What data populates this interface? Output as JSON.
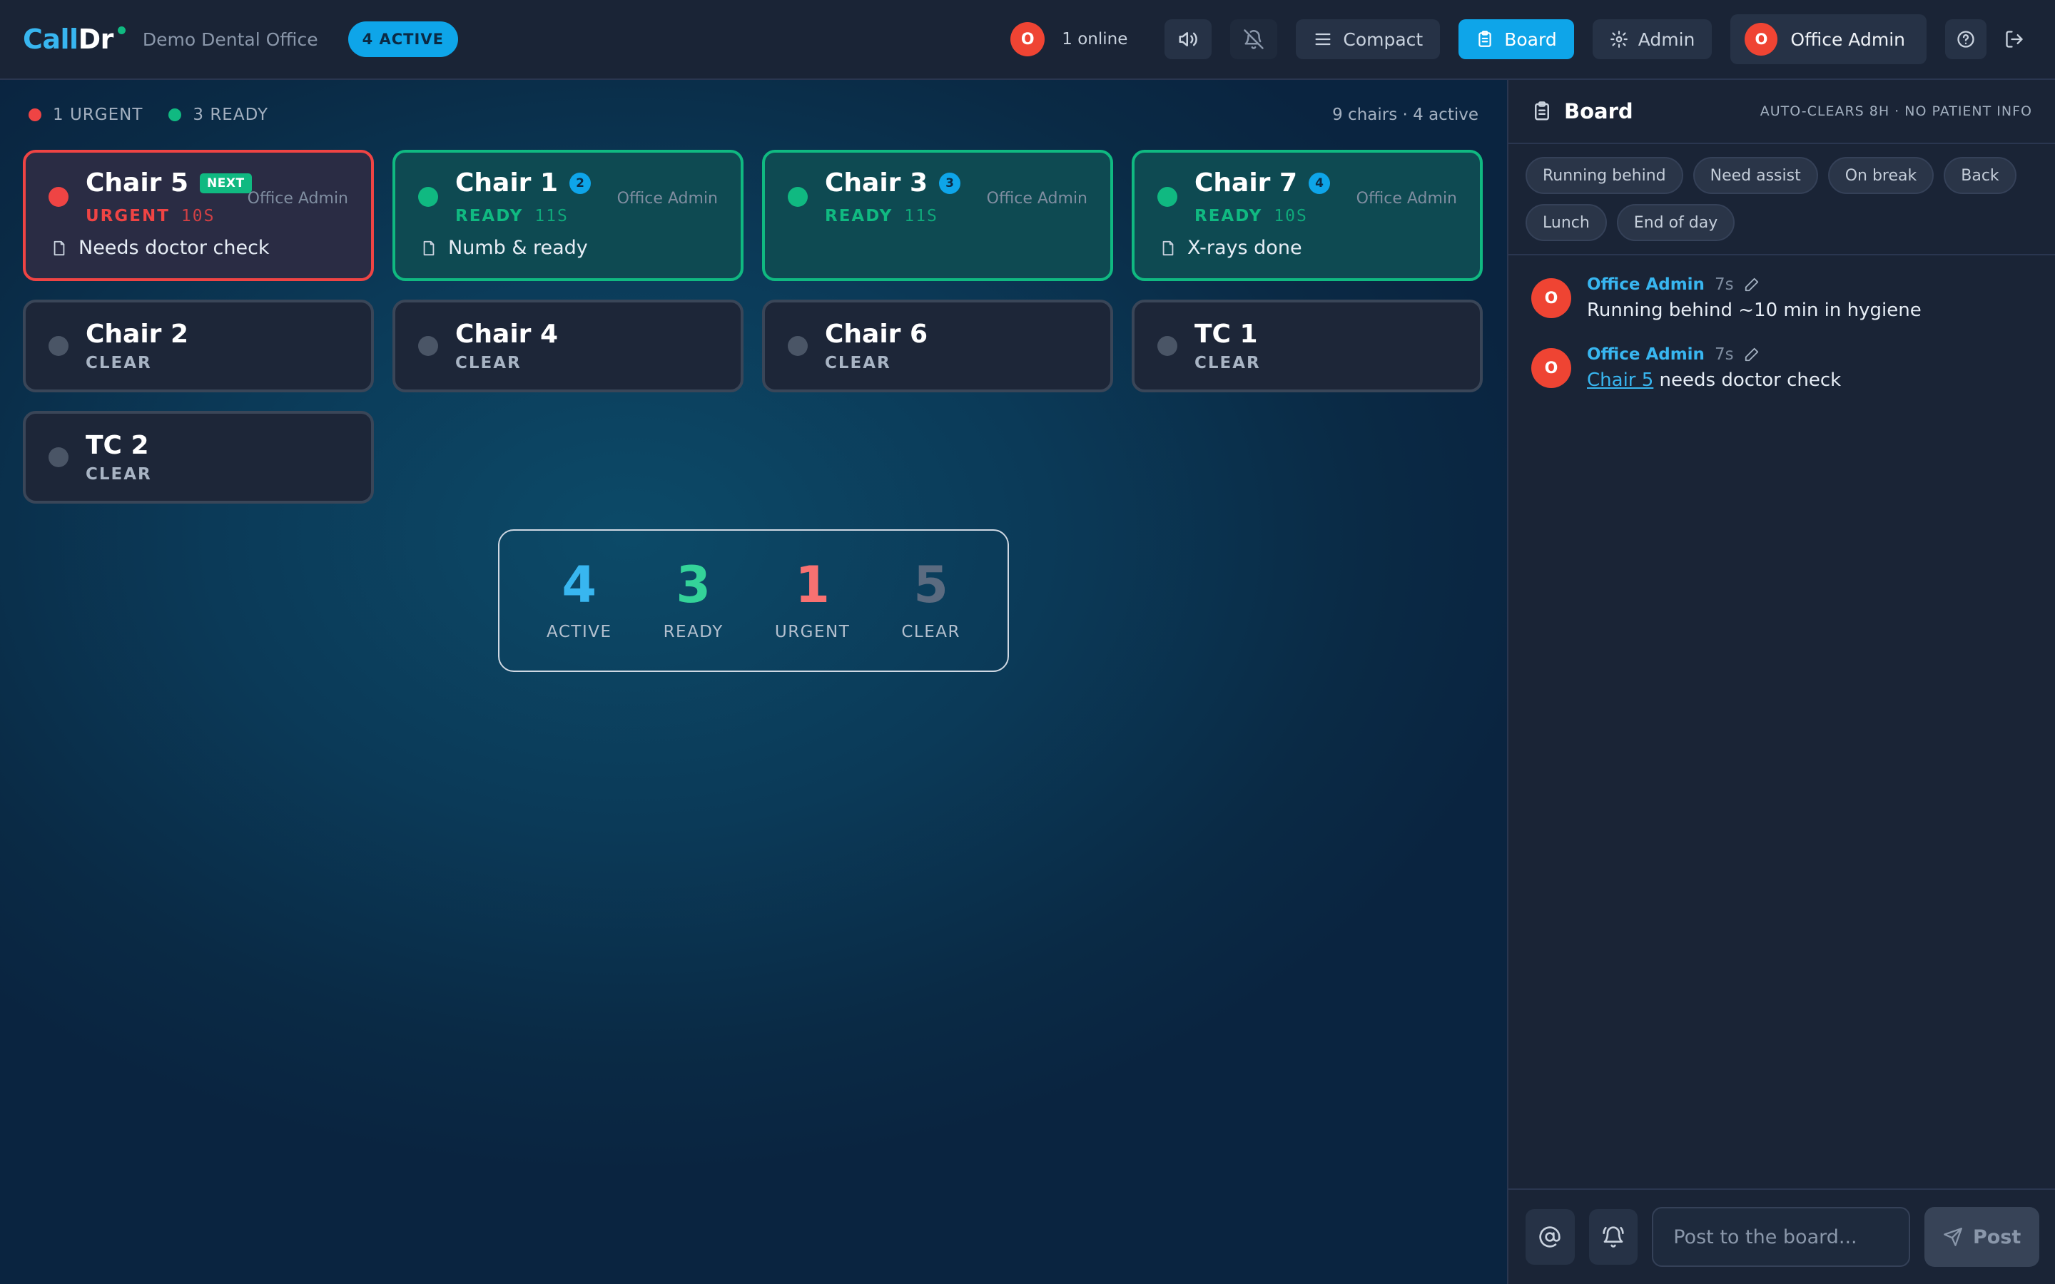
{
  "header": {
    "logo_call": "Call",
    "logo_dr": "Dr",
    "office_name": "Demo Dental Office",
    "active_badge": "4 ACTIVE",
    "online_avatar_initial": "O",
    "online_text": "1 online",
    "compact_label": "Compact",
    "board_label": "Board",
    "admin_label": "Admin",
    "user_initial": "O",
    "user_name": "Office Admin"
  },
  "summary": {
    "urgent_text": "1 URGENT",
    "ready_text": "3 READY",
    "chair_count_text": "9 chairs · 4 active"
  },
  "chairs": [
    {
      "name": "Chair 5",
      "badge": "NEXT",
      "status": "URGENT",
      "time": "10S",
      "owner": "Office Admin",
      "note": "Needs doctor check"
    },
    {
      "name": "Chair 1",
      "badge": "2",
      "status": "READY",
      "time": "11S",
      "owner": "Office Admin",
      "note": "Numb & ready"
    },
    {
      "name": "Chair 3",
      "badge": "3",
      "status": "READY",
      "time": "11S",
      "owner": "Office Admin",
      "note": ""
    },
    {
      "name": "Chair 7",
      "badge": "4",
      "status": "READY",
      "time": "10S",
      "owner": "Office Admin",
      "note": "X-rays done"
    },
    {
      "name": "Chair 2",
      "status": "CLEAR"
    },
    {
      "name": "Chair 4",
      "status": "CLEAR"
    },
    {
      "name": "Chair 6",
      "status": "CLEAR"
    },
    {
      "name": "TC 1",
      "status": "CLEAR"
    },
    {
      "name": "TC 2",
      "status": "CLEAR"
    }
  ],
  "stats": [
    {
      "value": "4",
      "label": "ACTIVE",
      "color": "#38b6f0"
    },
    {
      "value": "3",
      "label": "READY",
      "color": "#34d399"
    },
    {
      "value": "1",
      "label": "URGENT",
      "color": "#f87171"
    },
    {
      "value": "5",
      "label": "CLEAR",
      "color": "#5b6b80"
    }
  ],
  "panel": {
    "title": "Board",
    "note": "AUTO-CLEARS 8H · NO PATIENT INFO",
    "quick_actions": [
      "Running behind",
      "Need assist",
      "On break",
      "Back",
      "Lunch",
      "End of day"
    ],
    "messages": [
      {
        "initial": "O",
        "author": "Office Admin",
        "time": "7s",
        "text": "Running behind ~10 min in hygiene"
      },
      {
        "initial": "O",
        "author": "Office Admin",
        "time": "7s",
        "link": "Chair 5",
        "text": " needs doctor check"
      }
    ],
    "composer_placeholder": "Post to the board...",
    "post_label": "Post"
  },
  "colors": {
    "accent": "#0ea5e9",
    "urgent": "#ef4444",
    "ready": "#10b981",
    "clear": "#4a5566"
  }
}
